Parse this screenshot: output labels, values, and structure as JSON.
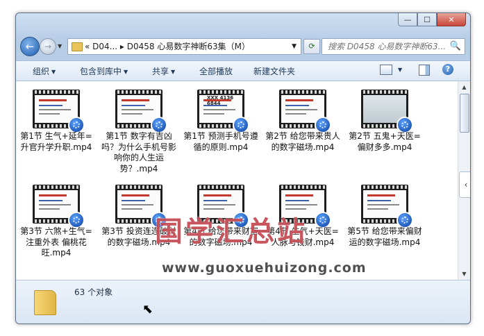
{
  "window": {
    "caption_buttons": {
      "minimize": "—",
      "maximize": "☐",
      "close": "✕"
    }
  },
  "nav": {
    "back_icon": "←",
    "forward_icon": "→",
    "address": "« D04... ▸ D0458 心易数字神断63集（M）",
    "refresh_icon": "⟳",
    "search_placeholder": "搜索 D0458 心易数字神断63...",
    "search_icon": "🔍"
  },
  "toolbar": {
    "organize": "组织",
    "include_in_library": "包含到库中",
    "share": "共享",
    "play_all": "全部播放",
    "new_folder": "新建文件夹",
    "help": "?"
  },
  "files": [
    {
      "name": "第1节 生气+延年=升官升学升职.mp4",
      "thumb_text": "",
      "style": "slide"
    },
    {
      "name": "第1节 数字有吉凶吗？为什么手机号影响你的人生运势？.mp4",
      "thumb_text": "",
      "style": "slide"
    },
    {
      "name": "第1节 预测手机号遵循的原则.mp4",
      "thumb_text": "XXX 4136 6844",
      "style": "slide"
    },
    {
      "name": "第2节 给您带来贵人的数字磁场.mp4",
      "thumb_text": "",
      "style": "slide"
    },
    {
      "name": "第2节 五鬼+天医=偏财多多.mp4",
      "thumb_text": "",
      "style": "grey"
    },
    {
      "name": "第3节 六煞+生气=注重外表 偏桃花旺.mp4",
      "thumb_text": "",
      "style": "slide"
    },
    {
      "name": "第3节 投资连连破财的数字磁场.mp4",
      "thumb_text": "",
      "style": "slide"
    },
    {
      "name": "第4节 给您带来财富的数字磁场.mp4",
      "thumb_text": "",
      "style": "slide"
    },
    {
      "name": "第4节 生气+天医=人脉与钱财.mp4",
      "thumb_text": "",
      "style": "slide"
    },
    {
      "name": "第5节 给您带来偏财运的数字磁场.mp4",
      "thumb_text": "",
      "style": "slide"
    },
    {
      "name": "",
      "thumb_text": "",
      "style": "slide"
    },
    {
      "name": "",
      "thumb_text": "",
      "style": "slide"
    },
    {
      "name": "",
      "thumb_text": "",
      "style": "slide"
    },
    {
      "name": "",
      "thumb_text": "",
      "style": "slide"
    },
    {
      "name": "",
      "thumb_text": "",
      "style": "slide"
    }
  ],
  "watermark": {
    "title": "国学汇总站",
    "url": "www.guoxuehuizong.com"
  },
  "details": {
    "count": "63 个对象"
  },
  "colors": {
    "accent": "#1f5fb0",
    "badge": "#0b3c9c",
    "watermark": "#b41e28"
  }
}
